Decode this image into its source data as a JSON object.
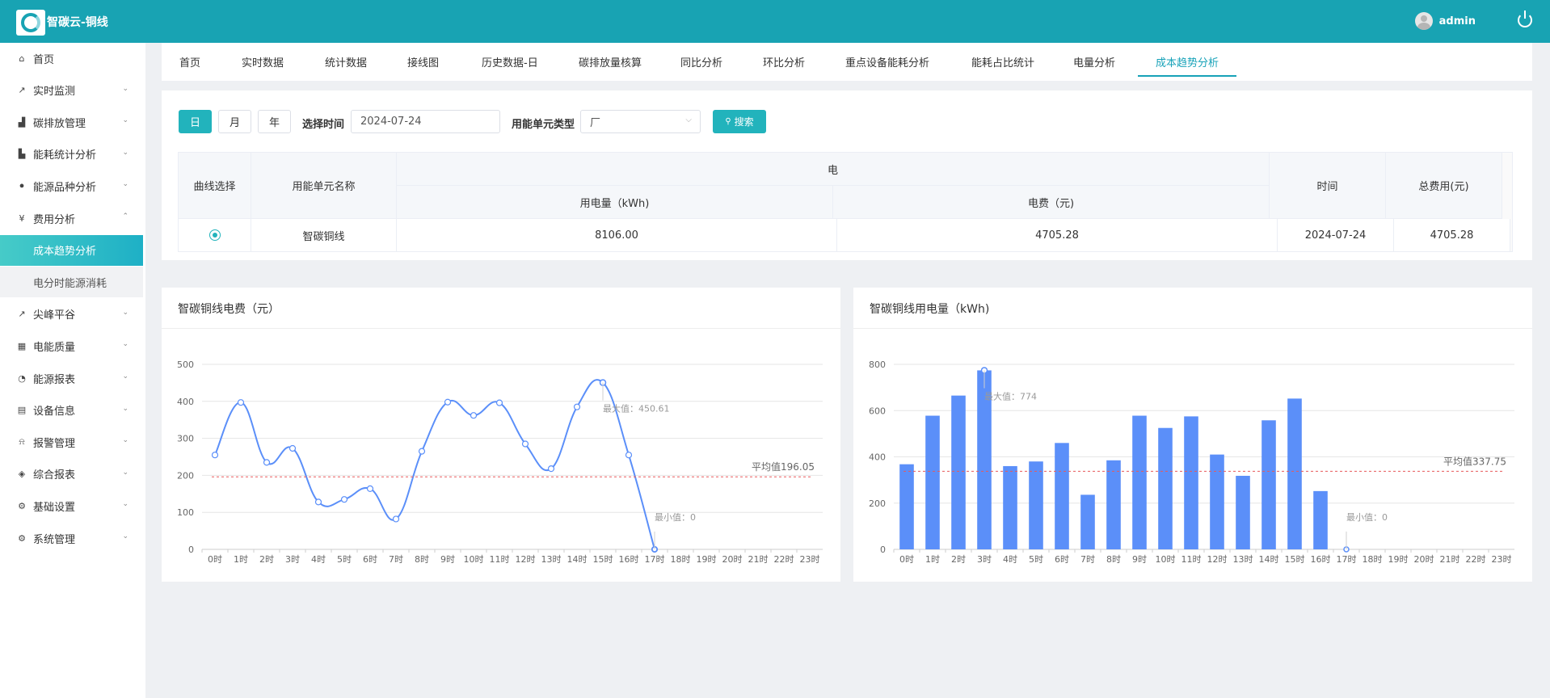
{
  "header": {
    "app_title": "智碳云-铜线",
    "user_name": "admin"
  },
  "sidebar": {
    "items": [
      {
        "label": "首页",
        "icon": "home-icon",
        "glyph": "⌂",
        "chev": ""
      },
      {
        "label": "实时监测",
        "icon": "trend-icon",
        "glyph": "↗",
        "chev": "⌄"
      },
      {
        "label": "碳排放管理",
        "icon": "bar-chart-icon",
        "glyph": "▟",
        "chev": "⌄"
      },
      {
        "label": "能耗统计分析",
        "icon": "column-chart-icon",
        "glyph": "▙",
        "chev": "⌄"
      },
      {
        "label": "能源品种分析",
        "icon": "signal-icon",
        "glyph": "⦁",
        "chev": "⌄"
      },
      {
        "label": "费用分析",
        "icon": "yen-icon",
        "glyph": "¥",
        "chev": "⌃"
      }
    ],
    "sub_items": [
      {
        "label": "成本趋势分析",
        "active": true
      },
      {
        "label": "电分时能源消耗",
        "active": false
      }
    ],
    "items_after": [
      {
        "label": "尖峰平谷",
        "icon": "line-chart-icon",
        "glyph": "↗",
        "chev": "⌄"
      },
      {
        "label": "电能质量",
        "icon": "calendar-icon",
        "glyph": "▦",
        "chev": "⌄"
      },
      {
        "label": "能源报表",
        "icon": "pie-chart-icon",
        "glyph": "◔",
        "chev": "⌄"
      },
      {
        "label": "设备信息",
        "icon": "document-icon",
        "glyph": "▤",
        "chev": "⌄"
      },
      {
        "label": "报警管理",
        "icon": "alarm-icon",
        "glyph": "⍾",
        "chev": "⌄"
      },
      {
        "label": "综合报表",
        "icon": "layers-icon",
        "glyph": "◈",
        "chev": "⌄"
      },
      {
        "label": "基础设置",
        "icon": "gear-icon",
        "glyph": "⚙",
        "chev": "⌄"
      },
      {
        "label": "系统管理",
        "icon": "gear-icon",
        "glyph": "⚙",
        "chev": "⌄"
      }
    ]
  },
  "tabs": [
    {
      "label": "首页"
    },
    {
      "label": "实时数据"
    },
    {
      "label": "统计数据"
    },
    {
      "label": "接线图"
    },
    {
      "label": "历史数据-日"
    },
    {
      "label": "碳排放量核算"
    },
    {
      "label": "同比分析"
    },
    {
      "label": "环比分析"
    },
    {
      "label": "重点设备能耗分析"
    },
    {
      "label": "能耗占比统计"
    },
    {
      "label": "电量分析"
    },
    {
      "label": "成本趋势分析",
      "active": true
    }
  ],
  "filters": {
    "period_buttons": [
      "日",
      "月",
      "年"
    ],
    "active_period": "日",
    "time_label": "选择时间",
    "date_value": "2024-07-24",
    "unit_type_label": "用能单元类型",
    "unit_type_value": "厂",
    "search_label": "搜索"
  },
  "table": {
    "headers": {
      "curve_select": "曲线选择",
      "unit_name": "用能单元名称",
      "group": "电",
      "usage": "用电量（kWh)",
      "cost": "电费（元)",
      "time": "时间",
      "total": "总费用(元)"
    },
    "row": {
      "unit_name": "智碳铜线",
      "usage": "8106.00",
      "cost": "4705.28",
      "time": "2024-07-24",
      "total": "4705.28"
    }
  },
  "colors": {
    "accent": "#18a3b3",
    "series": "#5b8ff9",
    "average_line": "#e8595b"
  },
  "chart_data": [
    {
      "type": "line",
      "title": "智碳铜线电费（元）",
      "x": [
        "0时",
        "1时",
        "2时",
        "3时",
        "4时",
        "5时",
        "6时",
        "7时",
        "8时",
        "9时",
        "10时",
        "11时",
        "12时",
        "13时",
        "14时",
        "15时",
        "16时",
        "17时",
        "18时",
        "19时",
        "20时",
        "21时",
        "22时",
        "23时"
      ],
      "values": [
        255,
        397,
        235,
        273,
        128,
        135,
        164,
        82,
        265,
        398,
        362,
        396,
        285,
        218,
        385,
        450.61,
        255,
        0
      ],
      "ylim": [
        0,
        500
      ],
      "yticks": [
        0,
        100,
        200,
        300,
        400,
        500
      ],
      "max_label": "最大值：450.61",
      "min_label": "最小值：0",
      "average_label": "平均值196.05",
      "average": 196.05,
      "grid": true
    },
    {
      "type": "bar",
      "title": "智碳铜线用电量（kWh)",
      "x": [
        "0时",
        "1时",
        "2时",
        "3时",
        "4时",
        "5时",
        "6时",
        "7时",
        "8时",
        "9时",
        "10时",
        "11时",
        "12时",
        "13时",
        "14时",
        "15时",
        "16时",
        "17时",
        "18时",
        "19时",
        "20时",
        "21时",
        "22时",
        "23时"
      ],
      "values": [
        368,
        578,
        665,
        774,
        360,
        380,
        460,
        236,
        385,
        578,
        525,
        575,
        410,
        318,
        558,
        652,
        252,
        0
      ],
      "ylim": [
        0,
        800
      ],
      "yticks": [
        0,
        200,
        400,
        600,
        800
      ],
      "max_label": "最大值：774",
      "min_label": "最小值：0",
      "average_label": "平均值337.75",
      "average": 337.75,
      "grid": true
    }
  ]
}
